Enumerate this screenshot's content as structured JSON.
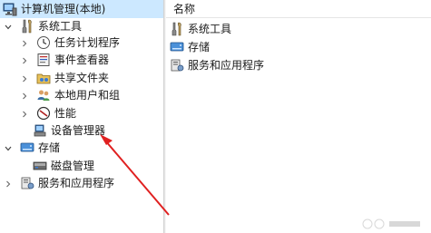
{
  "tree": {
    "root_label": "计算机管理(本地)",
    "system_tools_label": "系统工具",
    "task_scheduler_label": "任务计划程序",
    "event_viewer_label": "事件查看器",
    "shared_folders_label": "共享文件夹",
    "local_users_label": "本地用户和组",
    "performance_label": "性能",
    "device_manager_label": "设备管理器",
    "storage_label": "存储",
    "disk_management_label": "磁盘管理",
    "services_apps_label": "服务和应用程序"
  },
  "list": {
    "header_name": "名称",
    "items": [
      "系统工具",
      "存储",
      "服务和应用程序"
    ]
  },
  "colors": {
    "selected_bg": "#cce8ff",
    "arrow": "#e02020"
  }
}
